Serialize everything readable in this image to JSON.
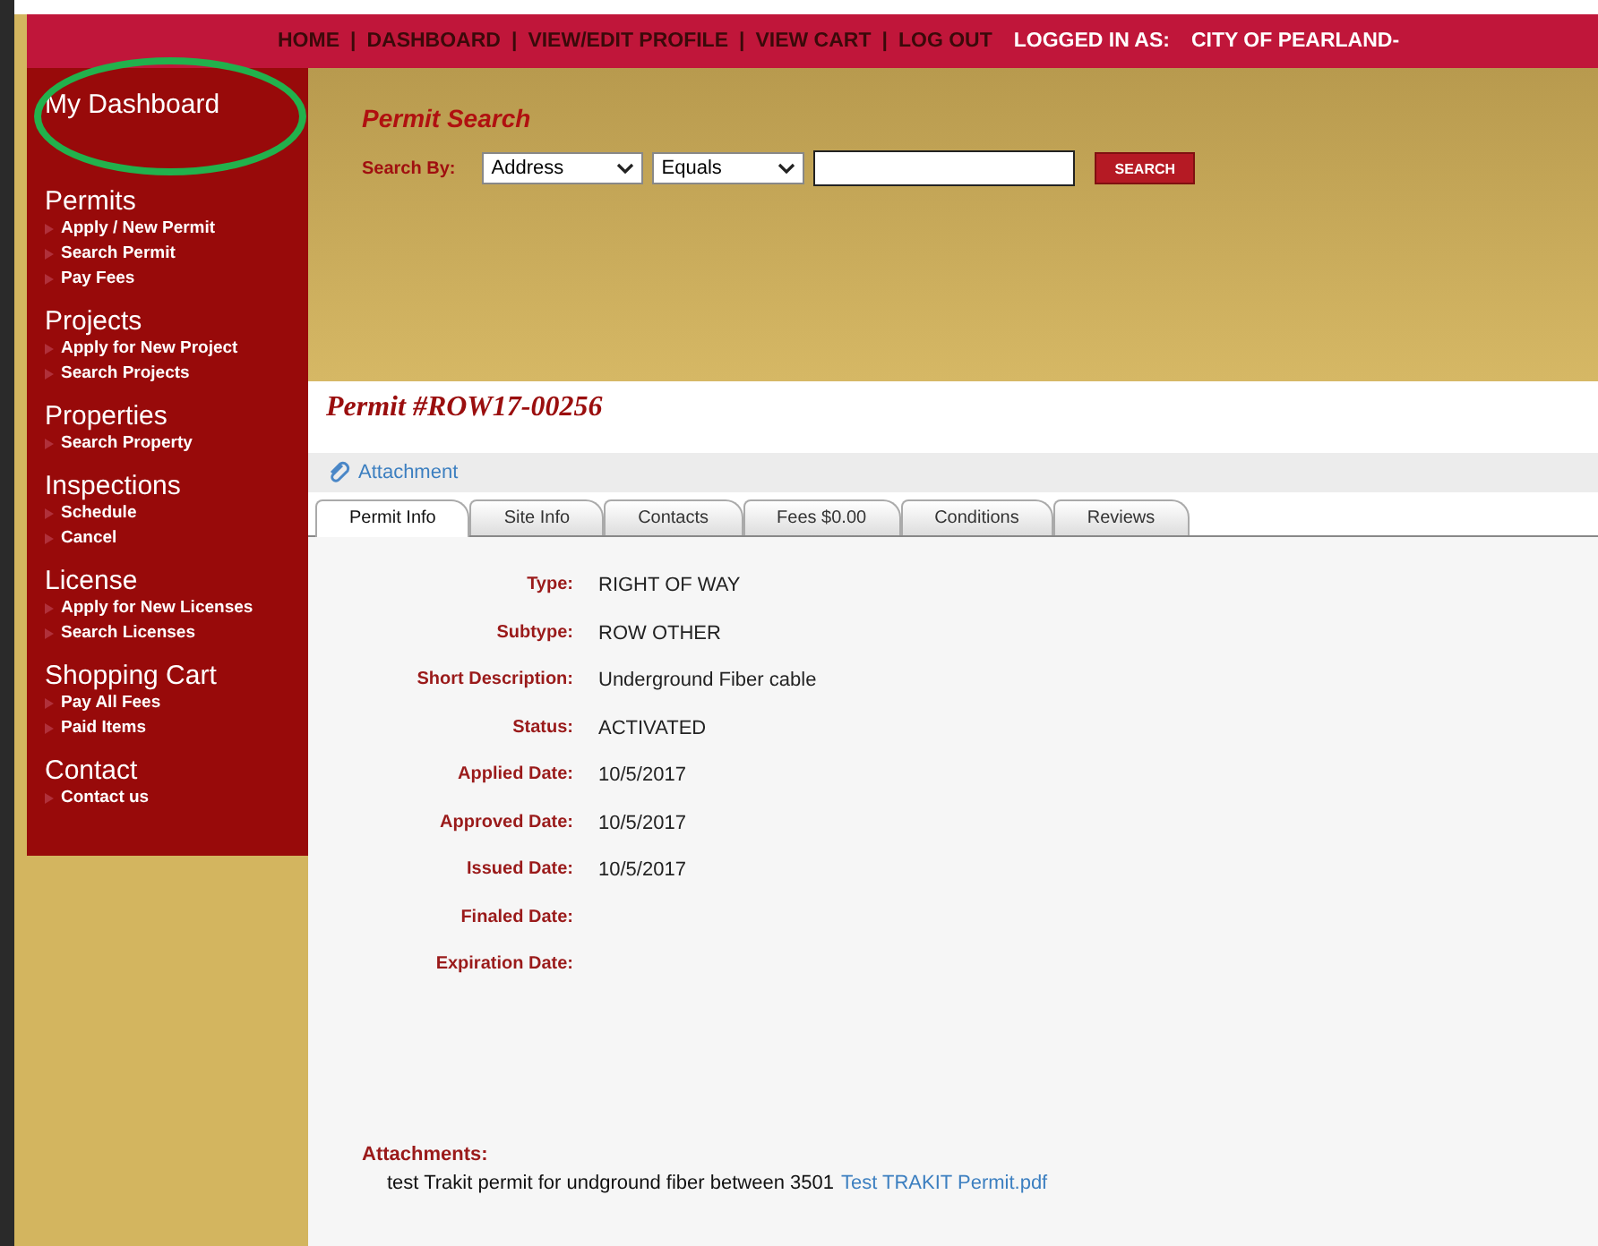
{
  "top_nav": {
    "links": [
      "HOME",
      "DASHBOARD",
      "VIEW/EDIT PROFILE",
      "VIEW CART",
      "LOG OUT"
    ],
    "separator": "|",
    "logged_in_label": "LOGGED IN AS:",
    "logged_in_user": "CITY OF PEARLAND-"
  },
  "sidebar": {
    "title": "My Dashboard",
    "circled": true,
    "sections": [
      {
        "heading": "Permits",
        "items": [
          "Apply / New Permit",
          "Search Permit",
          "Pay Fees"
        ]
      },
      {
        "heading": "Projects",
        "items": [
          "Apply for New Project",
          "Search Projects"
        ]
      },
      {
        "heading": "Properties",
        "items": [
          "Search Property"
        ]
      },
      {
        "heading": "Inspections",
        "items": [
          "Schedule",
          "Cancel"
        ]
      },
      {
        "heading": "License",
        "items": [
          "Apply for New Licenses",
          "Search Licenses"
        ]
      },
      {
        "heading": "Shopping Cart",
        "items": [
          "Pay All Fees",
          "Paid Items"
        ]
      },
      {
        "heading": "Contact",
        "items": [
          "Contact us"
        ]
      }
    ]
  },
  "permit_search": {
    "title": "Permit Search",
    "search_by_label": "Search By:",
    "field_select": "Address",
    "operator_select": "Equals",
    "search_button": "SEARCH"
  },
  "permit": {
    "title": "Permit #ROW17-00256",
    "attachment_link": "Attachment",
    "tabs": [
      {
        "label": "Permit Info",
        "selected": true
      },
      {
        "label": "Site Info",
        "selected": false
      },
      {
        "label": "Contacts",
        "selected": false
      },
      {
        "label": "Fees $0.00",
        "selected": false
      },
      {
        "label": "Conditions",
        "selected": false
      },
      {
        "label": "Reviews",
        "selected": false
      }
    ],
    "fields": [
      {
        "label": "Type:",
        "value": "RIGHT OF WAY"
      },
      {
        "label": "Subtype:",
        "value": "ROW OTHER"
      },
      {
        "label": "Short Description:",
        "value": "Underground Fiber cable"
      },
      {
        "label": "Status:",
        "value": "ACTIVATED"
      },
      {
        "label": "Applied Date:",
        "value": "10/5/2017"
      },
      {
        "label": "Approved Date:",
        "value": "10/5/2017"
      },
      {
        "label": "Issued Date:",
        "value": "10/5/2017"
      },
      {
        "label": "Finaled Date:"
      },
      {
        "label": "Expiration Date:"
      }
    ],
    "attachments_label": "Attachments:",
    "attachment_description": "test Trakit permit for undground fiber between 3501",
    "attachment_file": "Test TRAKIT Permit.pdf"
  }
}
